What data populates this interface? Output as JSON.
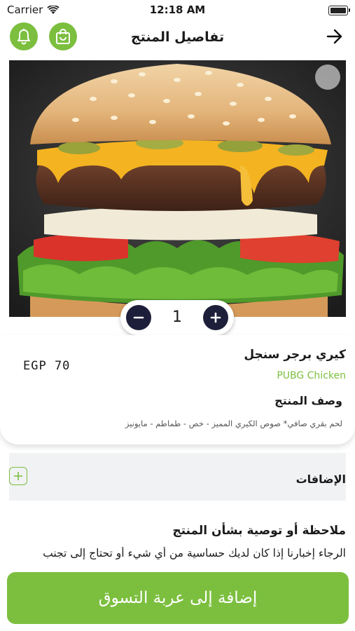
{
  "status_bar": {
    "carrier": "Carrier",
    "time": "12:18 AM"
  },
  "header": {
    "title": "تفاصيل المنتج",
    "icons": {
      "bell": "bell-icon",
      "bag": "shopping-bag-icon",
      "back": "arrow-right-icon"
    }
  },
  "product": {
    "image": "burger-photo",
    "quantity": "1",
    "name": "كيري برجر سنجل",
    "restaurant": "PUBG Chicken",
    "price": "EGP 70",
    "description_title": "وصف المنتج",
    "description": "لحم بقري صافي* صوص الكيري المميز - خص - طماطم - مايونيز"
  },
  "additions": {
    "title": "الإضافات"
  },
  "note": {
    "title": "ملاحظة أو توصية بشأن المنتج",
    "text": "الرجاء إخبارنا إذا كان لديك حساسية من أي شيء أو تحتاج إلى تجنب"
  },
  "cart_button": {
    "label": "إضافة إلى عربة التسوق"
  },
  "colors": {
    "accent": "#7cbf3f",
    "stepper": "#1d1f3a"
  }
}
